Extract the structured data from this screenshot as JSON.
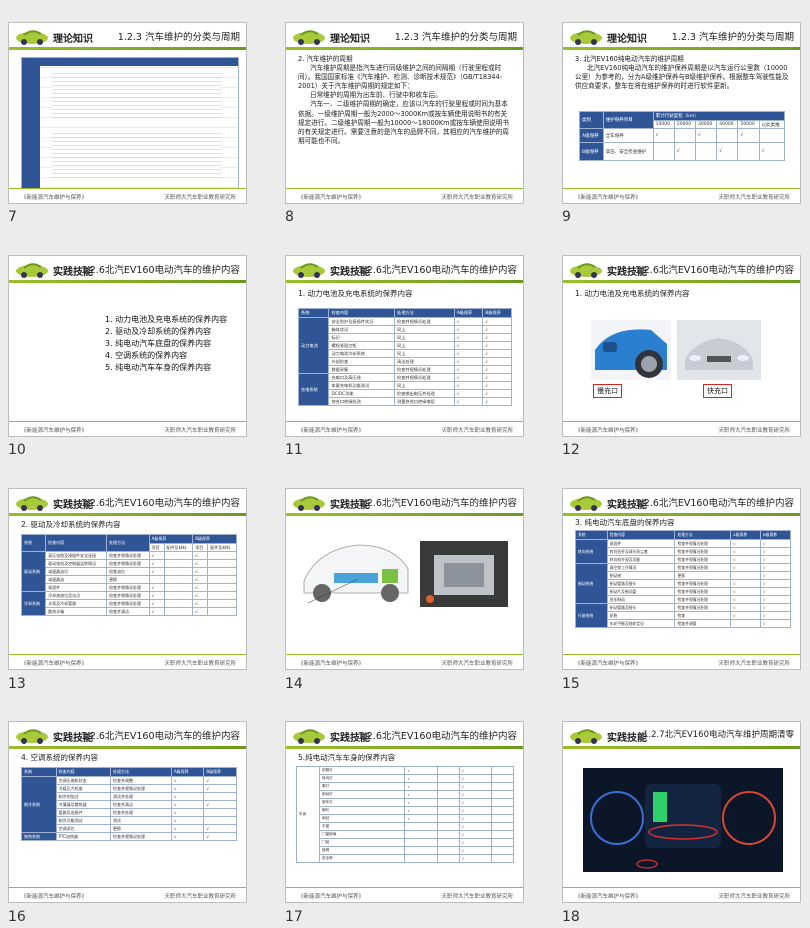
{
  "footer": {
    "left": "《新能源汽车维护与保养》",
    "right": "天职师大汽车职业教育研究所"
  },
  "slides": [
    {
      "number": "7",
      "section": "理论知识",
      "heading": "1.2.3 汽车维护的分类与周期"
    },
    {
      "number": "8",
      "section": "理论知识",
      "heading": "1.2.3 汽车维护的分类与周期",
      "lines": [
        "2. 汽车维护的周期",
        "汽车维护周期是指汽车进行同级维护之间的间隔期（行驶里程或时间）。我国国家标准《汽车维护、检测、诊断技术规范》（GB/T18344-2001）关于汽车维护周期的规定如下：",
        "日常维护的周期为出车前、行驶中和收车后。",
        "汽车一、二级维护周期的确定，应该以汽车的行驶里程或时间为基本依据。一级维护周期一般为2000～3000Km或按车辆使用说明书的有关规定进行。二级维护周期一般为10000～18000Km或按车辆使用说明书的有关规定进行。需要注意的是汽车的品牌不同，其相应的汽车维护的周期可能也不同。"
      ]
    },
    {
      "number": "9",
      "section": "理论知识",
      "heading": "1.2.3 汽车维护的分类与周期",
      "lines": [
        "3. 北汽EV160纯电动汽车的维护周期",
        "北汽EV160纯电动汽车的维护保养周期是以汽车运行公里数（10000公里）为参考的，分为A级维护保养与B级维护保养。根据整车驾驶性能及供应商要求，整车在将在维护保养的时进行软件更新。"
      ],
      "table_head": [
        "类别",
        "维护保养项目",
        "累计行驶里程（km）"
      ],
      "km": [
        "10000",
        "20000",
        "30000",
        "40000",
        "50000",
        "以此类推"
      ],
      "rows": [
        [
          "A级保养",
          "全车保养"
        ],
        [
          "B级保养",
          "高压、安全检查维护"
        ]
      ]
    },
    {
      "number": "10",
      "section": "实践技能",
      "heading": "1.2.6北汽EV160电动汽车的维护内容",
      "items": [
        "1.   动力电池及充电系统的保养内容",
        "2.   驱动及冷却系统的保养内容",
        "3.   纯电动汽车底盘的保养内容",
        "4.   空调系统的保养内容",
        "5.   纯电动汽车车身的保养内容"
      ]
    },
    {
      "number": "11",
      "section": "实践技能",
      "heading": "1.2.6北汽EV160电动汽车的维护内容",
      "subtitle": "1. 动力电池及充电系统的保养内容",
      "table_head": [
        "系统",
        "检查内容",
        "处理方法",
        "A级保养",
        "B级保养"
      ],
      "groups": [
        {
          "name": "动力电池",
          "rows": [
            [
              "安全防护及接插件状况",
              "检查并视情况处理"
            ],
            [
              "箱体状况",
              "同上"
            ],
            [
              "标识",
              "同上"
            ],
            [
              "螺栓紧固力矩",
              "同上"
            ],
            [
              "动力电池冷却系统",
              "同上"
            ],
            [
              "外部检查",
              "清洁处理"
            ],
            [
              "数据采集",
              "检查并视情况处理"
            ]
          ]
        },
        {
          "name": "充电系统",
          "rows": [
            [
              "充电口及高压线",
              "检查并视情况处理"
            ],
            [
              "车载充电机功能测试",
              "同上"
            ],
            [
              "DC/DC功能",
              "检查输出电压并处理"
            ],
            [
              "快充口绝缘检测",
              "测量快充口绝缘电阻"
            ]
          ]
        }
      ]
    },
    {
      "number": "12",
      "section": "实践技能",
      "heading": "1.2.6北汽EV160电动汽车的维护内容",
      "subtitle": "1. 动力电池及充电系统的保养内容",
      "callouts": [
        "慢充口",
        "快充口"
      ]
    },
    {
      "number": "13",
      "section": "实践技能",
      "heading": "1.2.6北汽EV160电动汽车的维护内容",
      "subtitle": "2. 驱动及冷却系统的保养内容",
      "table_head": [
        "系统",
        "检查内容",
        "处理方法",
        "A级保养",
        "B级保养"
      ],
      "sub_head": [
        "项目",
        "配件及材料",
        "项目",
        "配件及材料"
      ],
      "groups": [
        {
          "name": "驱动系统",
          "rows": [
            [
              "高压电缆及接插件安全连接",
              "检查并视情况处理"
            ],
            [
              "驱动电机及控制器运转情况",
              "检查并视情况处理"
            ],
            [
              "减速器油位",
              "检查油位"
            ],
            [
              "减速器油",
              "更换"
            ],
            [
              "紧固件",
              "检查并视情况处理"
            ]
          ]
        },
        {
          "name": "冷却系统",
          "rows": [
            [
              "冷却液液位及冰点",
              "检查并视情况处理"
            ],
            [
              "水泵及冷却管路",
              "检查并视情况处理"
            ],
            [
              "散热水箱",
              "检查并清洁"
            ]
          ]
        }
      ]
    },
    {
      "number": "14",
      "section": "实践技能",
      "heading": "1.2.6北汽EV160电动汽车的维护内容"
    },
    {
      "number": "15",
      "section": "实践技能",
      "heading": "1.2.6北汽EV160电动汽车的维护内容",
      "subtitle": "3. 纯电动汽车底盘的保养内容",
      "table_head": [
        "系统",
        "检查内容",
        "处理方法",
        "A级保养",
        "B级保养"
      ],
      "groups": [
        {
          "name": "转向系统",
          "rows": [
            [
              "紧固件",
              "检查并视情况处理"
            ],
            [
              "转向拉杆及球头防尘套",
              "检查并视情况处理"
            ],
            [
              "转向机外观及功能",
              "检查并视情况处理"
            ]
          ]
        },
        {
          "name": "制动系统",
          "rows": [
            [
              "真空泵工作情况",
              "检查并视情况处理"
            ],
            [
              "制动液",
              "更换"
            ],
            [
              "制动管路及接头",
              "检查并视情况处理"
            ],
            [
              "制动片及制动盘",
              "检查并视情况处理"
            ],
            [
              "驻车制动",
              "检查并视情况处理"
            ]
          ]
        },
        {
          "name": "行驶系统",
          "rows": [
            [
              "制动管路及接头",
              "检查并视情况处理"
            ],
            [
              "轮胎",
              "检查"
            ],
            [
              "车轮平衡及前轮定位",
              "检查并调整"
            ]
          ]
        }
      ]
    },
    {
      "number": "16",
      "section": "实践技能",
      "heading": "1.2.6北汽EV160电动汽车的维护内容",
      "subtitle": "4. 空调系统的保养内容",
      "table_head": [
        "系统",
        "检查内容",
        "处理方法",
        "A级保养",
        "B级保养"
      ],
      "groups": [
        {
          "name": "制冷系统",
          "rows": [
            [
              "空调压缩机状态",
              "检查并调整"
            ],
            [
              "冷媒压力检查",
              "检查并视情况处理"
            ],
            [
              "制冷剂加注",
              "测试并处理"
            ],
            [
              "冷凝器及散热器",
              "检查并清洁"
            ],
            [
              "管路及连接件",
              "检查并处理"
            ],
            [
              "制冷功能测试",
              "测试"
            ],
            [
              "空调滤芯",
              "更换"
            ]
          ]
        },
        {
          "name": "制热系统",
          "rows": [
            [
              "PTC加热器",
              "检查并视情况处理"
            ]
          ]
        }
      ]
    },
    {
      "number": "17",
      "section": "实践技能",
      "heading": "1.2.6北汽EV160电动汽车的维护内容",
      "subtitle": "5.纯电动汽车车身的保养内容",
      "group": "车身",
      "rows": [
        "前照灯",
        "转向灯",
        "雾灯",
        "制动灯",
        "倒车灯",
        "喇叭",
        "雨刮",
        "天窗",
        "门窗玻璃",
        "门锁",
        "座椅",
        "安全带"
      ]
    },
    {
      "number": "18",
      "section": "实践技能",
      "heading": "1.2.7北汽EV160电动汽车维护周期清零"
    }
  ]
}
